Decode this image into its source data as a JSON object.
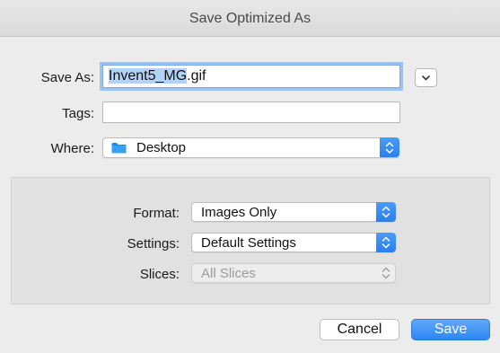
{
  "window": {
    "title": "Save Optimized As"
  },
  "save_as": {
    "label": "Save As:",
    "name_selected": "Invent5_MG",
    "name_extension": ".gif"
  },
  "tags": {
    "label": "Tags:",
    "value": ""
  },
  "where": {
    "label": "Where:",
    "value": "Desktop",
    "icon": "folder-icon",
    "icon_color": "#1d8be7"
  },
  "format": {
    "label": "Format:",
    "value": "Images Only"
  },
  "settings": {
    "label": "Settings:",
    "value": "Default Settings"
  },
  "slices": {
    "label": "Slices:",
    "value": "All Slices",
    "enabled": false
  },
  "buttons": {
    "cancel": "Cancel",
    "save": "Save"
  },
  "colors": {
    "accent": "#2f86f2",
    "selection": "#b2d2f7",
    "focus_ring": "#9cc2f3"
  }
}
